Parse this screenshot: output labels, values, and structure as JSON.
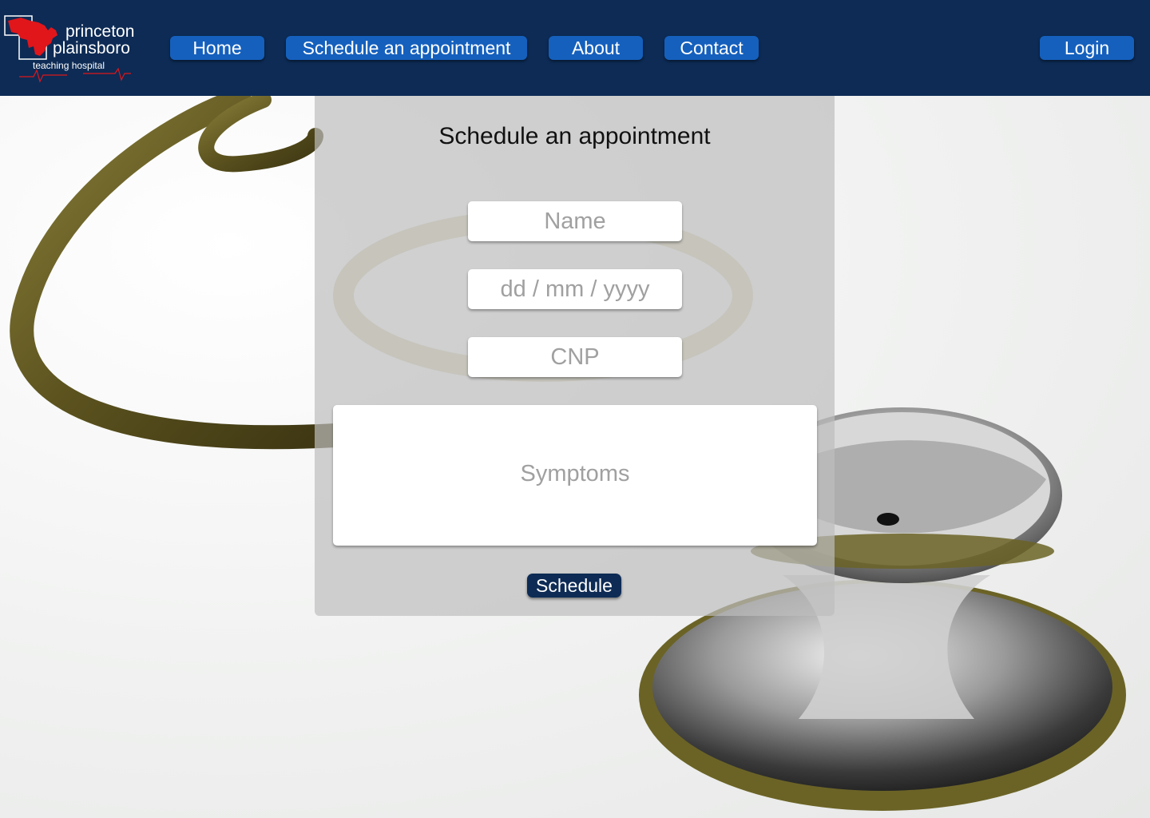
{
  "header": {
    "logo": {
      "line1": "princeton",
      "line2": "plainsboro",
      "tagline": "teaching hospital"
    },
    "nav": {
      "home": "Home",
      "schedule": "Schedule an appointment",
      "about": "About",
      "contact": "Contact",
      "login": "Login"
    }
  },
  "form": {
    "title": "Schedule an appointment",
    "name_placeholder": "Name",
    "date_placeholder": "dd / mm / yyyy",
    "cnp_placeholder": "CNP",
    "symptoms_placeholder": "Symptoms",
    "submit_label": "Schedule"
  },
  "colors": {
    "header_bg": "#0d2b55",
    "nav_button": "#1560bd",
    "submit_button": "#0d2b55",
    "card_overlay": "#bebebe",
    "logo_accent": "#e0161b"
  },
  "background": {
    "image": "stethoscope-photo"
  }
}
